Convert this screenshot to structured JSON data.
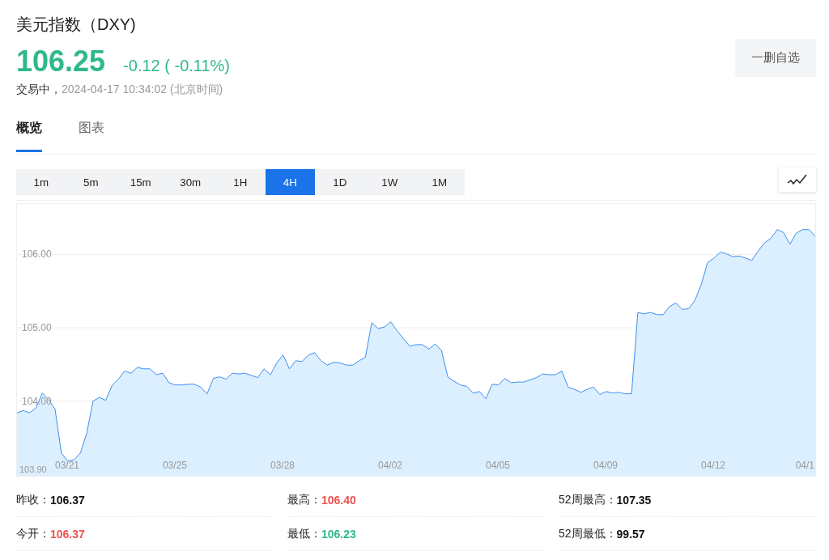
{
  "quote": {
    "title": "美元指数（DXY)",
    "price": "106.25",
    "change": "-0.12 ( -0.11%)",
    "status": "交易中，",
    "time": "2024-04-17 10:34:02 (北京时间)",
    "watch_button": "一删自选",
    "color": "#2fb98a"
  },
  "tabs": [
    {
      "label": "概览",
      "selected": true
    },
    {
      "label": "图表",
      "selected": false
    }
  ],
  "periods": [
    {
      "label": "1m",
      "selected": false
    },
    {
      "label": "5m",
      "selected": false
    },
    {
      "label": "15m",
      "selected": false
    },
    {
      "label": "30m",
      "selected": false
    },
    {
      "label": "1H",
      "selected": false
    },
    {
      "label": "4H",
      "selected": true
    },
    {
      "label": "1D",
      "selected": false
    },
    {
      "label": "1W",
      "selected": false
    },
    {
      "label": "1M",
      "selected": false
    }
  ],
  "chart": {
    "bottom_label": "103.90",
    "date_labels": [
      "03/21",
      "03/25",
      "03/28",
      "04/02",
      "04/05",
      "04/09",
      "04/12",
      "04/1"
    ],
    "chart_data": {
      "type": "area",
      "grid": true,
      "ylim": [
        102.98,
        106.69
      ],
      "yticks": [
        {
          "value": 104,
          "label": "104.00"
        },
        {
          "value": 105,
          "label": "105.00"
        },
        {
          "value": 106,
          "label": "106.00"
        }
      ],
      "series": [
        {
          "color": "#3d8ef0",
          "values": [
            103.84,
            103.87,
            103.84,
            103.91,
            104.11,
            104.02,
            103.89,
            103.29,
            103.18,
            103.2,
            103.29,
            103.56,
            104.0,
            104.05,
            104.01,
            104.21,
            104.3,
            104.41,
            104.38,
            104.46,
            104.44,
            104.44,
            104.36,
            104.38,
            104.25,
            104.22,
            104.22,
            104.23,
            104.23,
            104.19,
            104.1,
            104.31,
            104.33,
            104.3,
            104.38,
            104.37,
            104.38,
            104.35,
            104.32,
            104.44,
            104.36,
            104.52,
            104.63,
            104.44,
            104.55,
            104.54,
            104.63,
            104.66,
            104.55,
            104.49,
            104.53,
            104.52,
            104.49,
            104.49,
            104.55,
            104.6,
            105.07,
            104.99,
            105.01,
            105.08,
            104.96,
            104.85,
            104.75,
            104.77,
            104.77,
            104.71,
            104.78,
            104.69,
            104.33,
            104.27,
            104.22,
            104.2,
            104.11,
            104.13,
            104.03,
            104.23,
            104.22,
            104.31,
            104.25,
            104.26,
            104.26,
            104.29,
            104.32,
            104.37,
            104.36,
            104.36,
            104.41,
            104.19,
            104.16,
            104.12,
            104.16,
            104.19,
            104.09,
            104.13,
            104.11,
            104.12,
            104.1,
            104.1,
            105.21,
            105.19,
            105.21,
            105.18,
            105.18,
            105.29,
            105.34,
            105.25,
            105.26,
            105.37,
            105.59,
            105.89,
            105.95,
            106.03,
            106.01,
            105.97,
            105.98,
            105.95,
            105.92,
            106.05,
            106.16,
            106.22,
            106.34,
            106.3,
            106.14,
            106.29,
            106.34,
            106.34,
            106.25
          ]
        }
      ]
    }
  },
  "stats": [
    {
      "label": "昨收：",
      "value": "106.37",
      "color": "#111111"
    },
    {
      "label": "最高：",
      "value": "106.40",
      "color": "#f0514f"
    },
    {
      "label": "52周最高：",
      "value": "107.35",
      "color": "#111111"
    },
    {
      "label": "今开：",
      "value": "106.37",
      "color": "#f0514f"
    },
    {
      "label": "最低：",
      "value": "106.23",
      "color": "#2fb98a"
    },
    {
      "label": "52周最低：",
      "value": "99.57",
      "color": "#111111"
    }
  ]
}
